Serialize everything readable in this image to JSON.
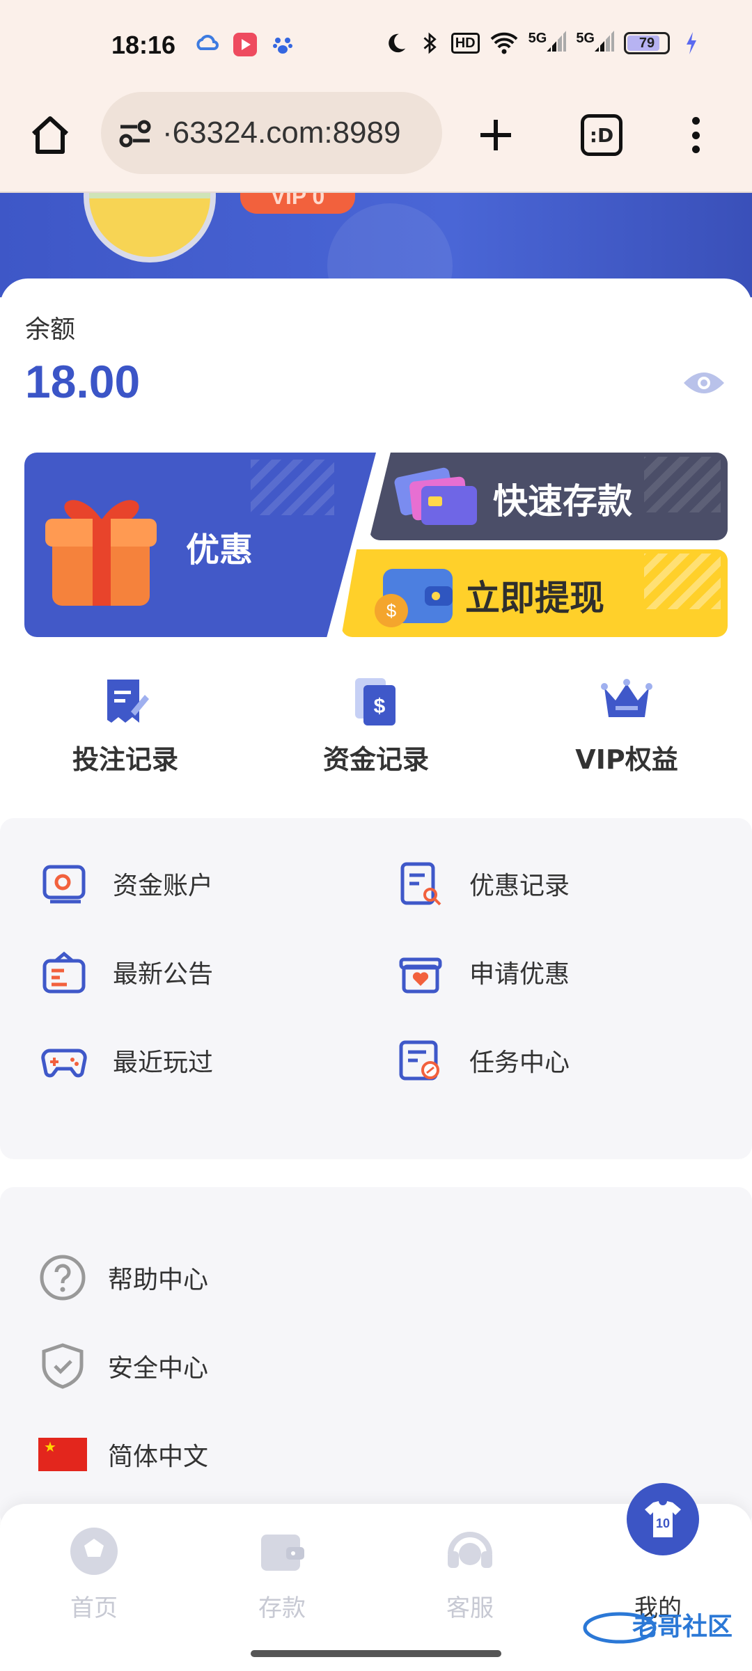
{
  "status_bar": {
    "time": "18:16",
    "hd": "HD",
    "net1": "5G",
    "net2": "5G",
    "battery": "79"
  },
  "browser": {
    "url": "·63324.com:8989",
    "tabs_label": ":D"
  },
  "header": {
    "vip_tag": "VIP 0"
  },
  "balance": {
    "label": "余额",
    "value": "18.00"
  },
  "actions": {
    "promo": "优惠",
    "deposit": "快速存款",
    "withdraw": "立即提现"
  },
  "quick_links": [
    {
      "label": "投注记录",
      "icon": "bet-record-icon"
    },
    {
      "label": "资金记录",
      "icon": "fund-record-icon"
    },
    {
      "label": "VIP权益",
      "icon": "crown-icon"
    }
  ],
  "menu_grid": [
    {
      "label": "资金账户",
      "icon": "account-card-icon"
    },
    {
      "label": "优惠记录",
      "icon": "promo-record-icon"
    },
    {
      "label": "最新公告",
      "icon": "announcement-icon"
    },
    {
      "label": "申请优惠",
      "icon": "gift-box-icon"
    },
    {
      "label": "最近玩过",
      "icon": "gamepad-icon"
    },
    {
      "label": "任务中心",
      "icon": "task-list-icon"
    }
  ],
  "settings": [
    {
      "label": "帮助中心",
      "icon": "help-icon"
    },
    {
      "label": "安全中心",
      "icon": "shield-icon"
    },
    {
      "label": "简体中文",
      "icon": "china-flag-icon"
    }
  ],
  "bottom_nav": [
    {
      "label": "首页",
      "icon": "soccer-ball-icon",
      "active": false
    },
    {
      "label": "存款",
      "icon": "wallet-icon",
      "active": false
    },
    {
      "label": "客服",
      "icon": "headset-icon",
      "active": false
    },
    {
      "label": "我的",
      "icon": "jersey-icon",
      "active": true
    }
  ],
  "jersey_number": "10",
  "watermark": "老哥社区",
  "colors": {
    "primary": "#3b55c7",
    "deposit_bg": "#4b4e68",
    "withdraw_bg": "#ffd02a",
    "panel_bg": "#f6f6f9",
    "status_bg": "#fbf0ea"
  }
}
